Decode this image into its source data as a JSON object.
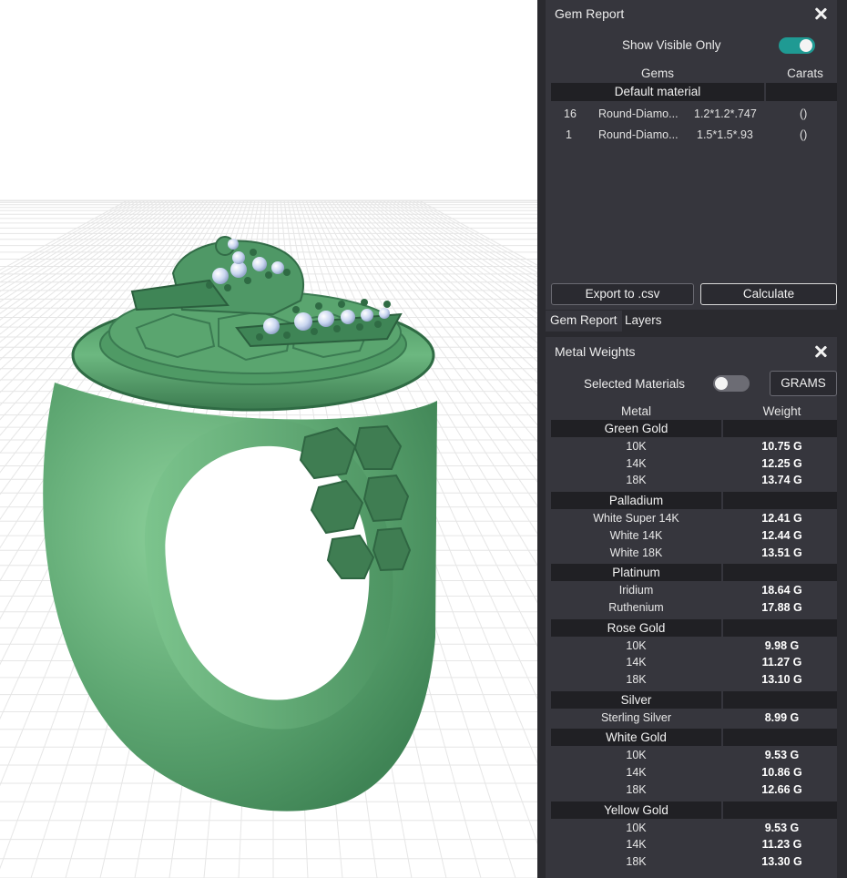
{
  "gem_report": {
    "title": "Gem Report",
    "show_visible_only_label": "Show Visible Only",
    "show_visible_only": true,
    "col_gems": "Gems",
    "col_carats": "Carats",
    "group": "Default material",
    "rows": [
      {
        "count": "16",
        "name": "Round-Diamo...",
        "size": "1.2*1.2*.747",
        "carats": "()"
      },
      {
        "count": "1",
        "name": "Round-Diamo...",
        "size": "1.5*1.5*.93",
        "carats": "()"
      }
    ],
    "export_label": "Export to .csv",
    "calculate_label": "Calculate"
  },
  "tabs": [
    "Gem Report",
    "Layers"
  ],
  "metal_weights": {
    "title": "Metal Weights",
    "selected_materials_label": "Selected Materials",
    "selected_materials": false,
    "unit_button": "GRAMS",
    "col_metal": "Metal",
    "col_weight": "Weight",
    "groups": [
      {
        "name": "Green Gold",
        "items": [
          {
            "metal": "10K",
            "weight": "10.75 G"
          },
          {
            "metal": "14K",
            "weight": "12.25 G"
          },
          {
            "metal": "18K",
            "weight": "13.74 G"
          }
        ]
      },
      {
        "name": "Palladium",
        "items": [
          {
            "metal": "White Super 14K",
            "weight": "12.41 G"
          },
          {
            "metal": "White 14K",
            "weight": "12.44 G"
          },
          {
            "metal": "White 18K",
            "weight": "13.51 G"
          }
        ]
      },
      {
        "name": "Platinum",
        "items": [
          {
            "metal": "Iridium",
            "weight": "18.64 G"
          },
          {
            "metal": "Ruthenium",
            "weight": "17.88 G"
          }
        ]
      },
      {
        "name": "Rose Gold",
        "items": [
          {
            "metal": "10K",
            "weight": "9.98 G"
          },
          {
            "metal": "14K",
            "weight": "11.27 G"
          },
          {
            "metal": "18K",
            "weight": "13.10 G"
          }
        ]
      },
      {
        "name": "Silver",
        "items": [
          {
            "metal": "Sterling Silver",
            "weight": "8.99 G"
          }
        ]
      },
      {
        "name": "White Gold",
        "items": [
          {
            "metal": "10K",
            "weight": "9.53 G"
          },
          {
            "metal": "14K",
            "weight": "10.86 G"
          },
          {
            "metal": "18K",
            "weight": "12.66 G"
          }
        ]
      },
      {
        "name": "Yellow Gold",
        "items": [
          {
            "metal": "10K",
            "weight": "9.53 G"
          },
          {
            "metal": "14K",
            "weight": "11.23 G"
          },
          {
            "metal": "18K",
            "weight": "13.30 G"
          }
        ]
      }
    ]
  },
  "colors": {
    "panel_bg": "#2a2a2f",
    "pane_bg": "#36363d",
    "group_bg": "#202024",
    "toggle_on": "#1f9a93",
    "ring_green": "#5fa873",
    "gem_blue": "#c9d6f0"
  }
}
